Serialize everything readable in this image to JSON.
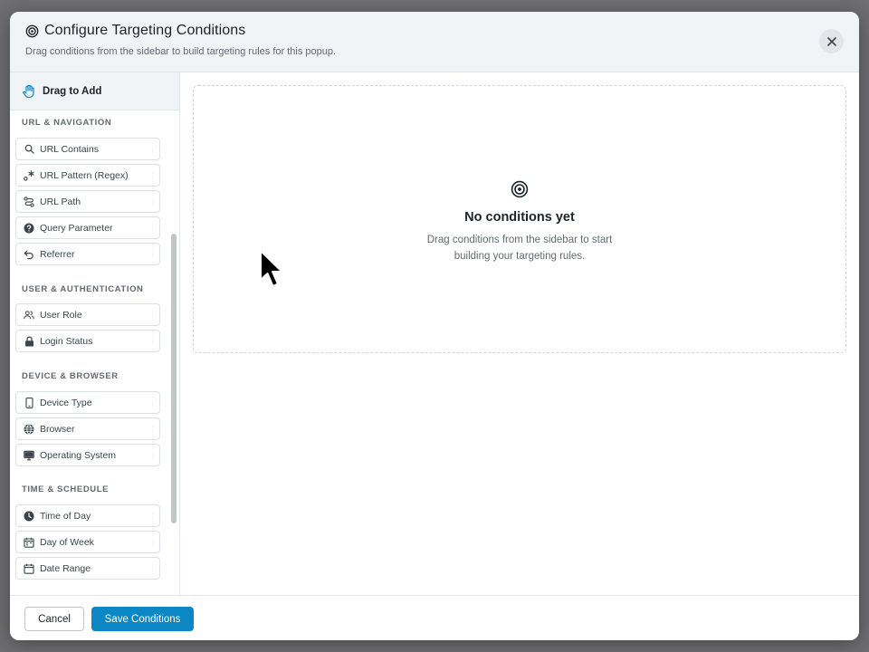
{
  "modal": {
    "title": "Configure Targeting Conditions",
    "subtitle": "Drag conditions from the sidebar to build targeting rules for this popup.",
    "close_icon": "close-icon",
    "title_icon": "target-icon"
  },
  "sidebar": {
    "header": "Drag to Add",
    "groups": [
      {
        "title": "URL & NAVIGATION",
        "items": [
          {
            "label": "URL Contains",
            "icon": "search-icon"
          },
          {
            "label": "URL Pattern (Regex)",
            "icon": "regex-icon"
          },
          {
            "label": "URL Path",
            "icon": "route-icon"
          },
          {
            "label": "Query Parameter",
            "icon": "question-icon"
          },
          {
            "label": "Referrer",
            "icon": "undo-icon"
          }
        ]
      },
      {
        "title": "USER & AUTHENTICATION",
        "items": [
          {
            "label": "User Role",
            "icon": "users-icon"
          },
          {
            "label": "Login Status",
            "icon": "lock-icon"
          }
        ]
      },
      {
        "title": "DEVICE & BROWSER",
        "items": [
          {
            "label": "Device Type",
            "icon": "phone-icon"
          },
          {
            "label": "Browser",
            "icon": "globe-icon"
          },
          {
            "label": "Operating System",
            "icon": "monitor-icon"
          }
        ]
      },
      {
        "title": "TIME & SCHEDULE",
        "items": [
          {
            "label": "Time of Day",
            "icon": "clock-icon"
          },
          {
            "label": "Day of Week",
            "icon": "calendar-icon"
          },
          {
            "label": "Date Range",
            "icon": "calendar-icon"
          }
        ]
      }
    ]
  },
  "empty_state": {
    "title": "No conditions yet",
    "desc_line1": "Drag conditions from the sidebar to start",
    "desc_line2": "building your targeting rules."
  },
  "footer": {
    "cancel_label": "Cancel",
    "save_label": "Save Conditions"
  },
  "colors": {
    "accent": "#0a87c4",
    "header_bg": "#f1f4f7"
  }
}
